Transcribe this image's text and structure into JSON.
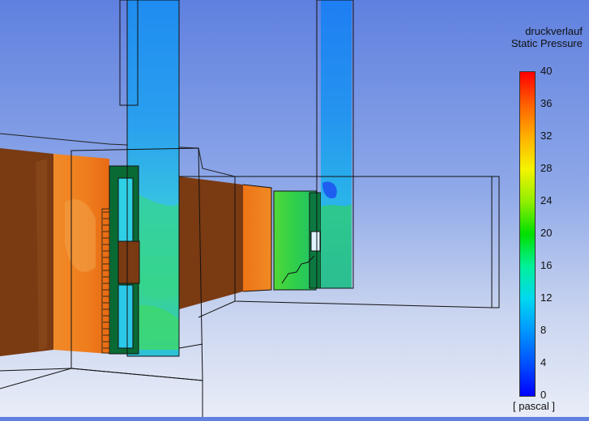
{
  "legend": {
    "title": "druckverlauf",
    "variable": "Static Pressure",
    "unit": "[ pascal ]",
    "ticks": [
      "40",
      "36",
      "32",
      "28",
      "24",
      "20",
      "16",
      "12",
      "8",
      "4",
      "0"
    ],
    "range": [
      0,
      40
    ],
    "colormap": [
      "#0000ff",
      "#0050ff",
      "#0096ff",
      "#00d8f0",
      "#00f09a",
      "#00e000",
      "#90ee00",
      "#f4f400",
      "#ffb000",
      "#ff6000",
      "#ff0000"
    ]
  },
  "colors": {
    "background_top": "#5f80df",
    "background_bottom": "#e9edf8",
    "wall_brown": "#7a3a12",
    "orange_high": "#ef7a1a",
    "cyan_low": "#2aa8ee",
    "green_mid": "#3ad25a",
    "outline": "#111111"
  }
}
